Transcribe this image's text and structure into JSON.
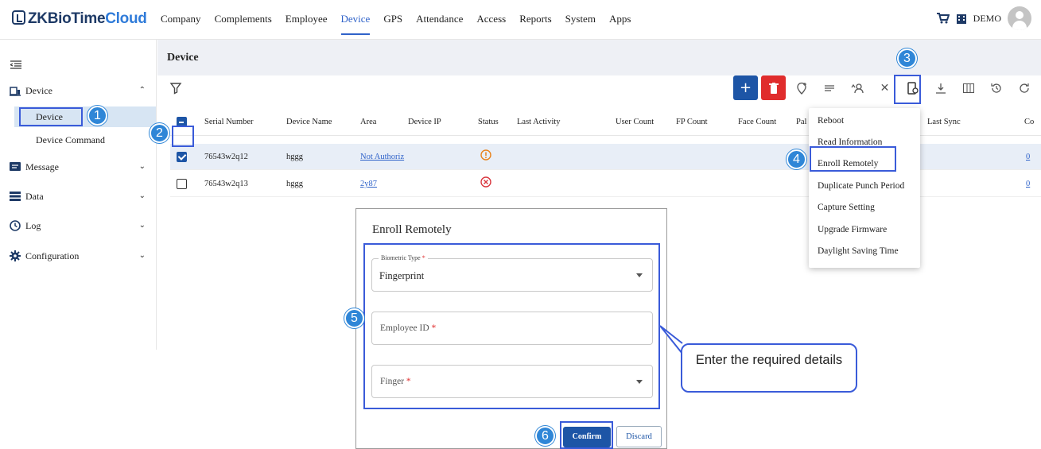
{
  "app": {
    "logo_prefix": "ZKBioTime",
    "logo_suffix": "Cloud",
    "user": "DEMO"
  },
  "nav": {
    "items": [
      "Company",
      "Complements",
      "Employee",
      "Device",
      "GPS",
      "Attendance",
      "Access",
      "Reports",
      "System",
      "Apps"
    ],
    "active": "Device"
  },
  "sidebar": {
    "groups": [
      {
        "label": "Device",
        "icon": "device-icon",
        "expanded": true
      },
      {
        "label": "Message",
        "icon": "message-icon"
      },
      {
        "label": "Data",
        "icon": "data-icon"
      },
      {
        "label": "Log",
        "icon": "clock-icon"
      },
      {
        "label": "Configuration",
        "icon": "gear-icon"
      }
    ],
    "device_sub": [
      {
        "label": "Device",
        "active": true
      },
      {
        "label": "Device Command"
      }
    ]
  },
  "page": {
    "title": "Device"
  },
  "table": {
    "columns": [
      "Serial Number",
      "Device Name",
      "Area",
      "Device IP",
      "Status",
      "Last Activity",
      "User Count",
      "FP Count",
      "Face Count",
      "Pal",
      "Last Sync",
      "Co"
    ],
    "rows": [
      {
        "serial": "76543w2q12",
        "name": "hggg",
        "area": "Not Authoriz",
        "status_icon": "warning-icon",
        "last_col": "0",
        "selected": true
      },
      {
        "serial": "76543w2q13",
        "name": "hggg",
        "area": "2y87",
        "status_icon": "error-icon",
        "last_col": "0",
        "selected": false
      }
    ]
  },
  "dropdown": {
    "items": [
      "Reboot",
      "Read Information",
      "Enroll Remotely",
      "Duplicate Punch Period",
      "Capture Setting",
      "Upgrade Firmware",
      "Daylight Saving Time"
    ]
  },
  "modal": {
    "title": "Enroll Remotely",
    "biometric_label": "Biometric Type",
    "biometric_value": "Fingerprint",
    "employee_placeholder": "Employee ID",
    "finger_placeholder": "Finger",
    "required_mark": "*",
    "confirm": "Confirm",
    "discard": "Discard"
  },
  "annotations": {
    "badges": [
      "1",
      "2",
      "3",
      "4",
      "5",
      "6"
    ],
    "callout_text": "Enter the required details",
    "color": "#3a5bd9",
    "badge_color": "#2f86d7"
  }
}
